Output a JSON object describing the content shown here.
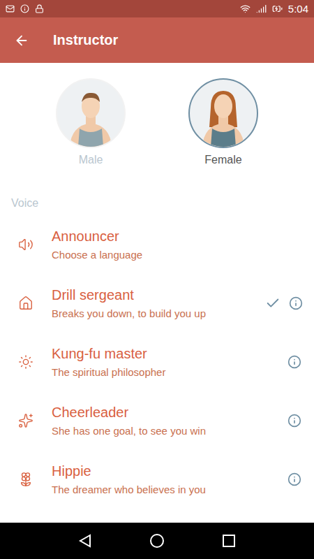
{
  "status_bar": {
    "time": "5:04"
  },
  "app_bar": {
    "title": "Instructor"
  },
  "gender": [
    {
      "label": "Male",
      "selected": false
    },
    {
      "label": "Female",
      "selected": true
    }
  ],
  "section": "Voice",
  "voices": [
    {
      "name": "Announcer",
      "description": "Choose a language",
      "selected": false,
      "info": false
    },
    {
      "name": "Drill sergeant",
      "description": "Breaks you down, to build you up",
      "selected": true,
      "info": true
    },
    {
      "name": "Kung-fu master",
      "description": "The spiritual philosopher",
      "selected": false,
      "info": true
    },
    {
      "name": "Cheerleader",
      "description": "She has one goal, to see you win",
      "selected": false,
      "info": true
    },
    {
      "name": "Hippie",
      "description": "The dreamer who believes in you",
      "selected": false,
      "info": true
    }
  ]
}
